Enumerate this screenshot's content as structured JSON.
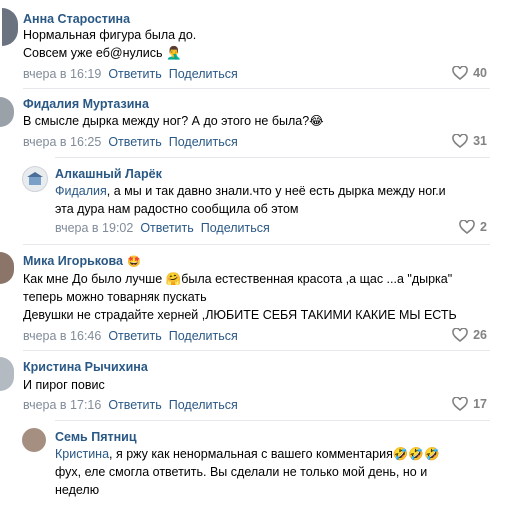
{
  "comments": [
    {
      "author": "Анна Старостина",
      "lines": [
        "Нормальная фигура была до.",
        "Совсем уже еб@нулись 🤦‍♂️"
      ],
      "time": "вчера в 16:19",
      "reply": "Ответить",
      "share": "Поделиться",
      "likes": "40"
    },
    {
      "author": "Фидалия Муртазина",
      "lines": [
        "В смысле дырка между ног? А до этого не была?😂"
      ],
      "time": "вчера в 16:25",
      "reply": "Ответить",
      "share": "Поделиться",
      "likes": "31"
    },
    {
      "author": "Алкашный Ларёк",
      "mention": "Фидалия",
      "lines": [
        ", а мы и так давно знали.что у неё есть дырка между ног.и",
        "эта дура нам радостно сообщила об этом"
      ],
      "time": "вчера в 19:02",
      "reply": "Ответить",
      "share": "Поделиться",
      "likes": "2"
    },
    {
      "author": "Мика Игорькова",
      "badge": "🤩",
      "lines": [
        "Как мне До было лучше 🤗была естественная красота ,а щас ...а \"дырка\"",
        "теперь можно товарняк пускать",
        "Девушки не страдайте херней ,ЛЮБИТЕ СЕБЯ ТАКИМИ КАКИЕ МЫ ЕСТЬ"
      ],
      "time": "вчера в 16:46",
      "reply": "Ответить",
      "share": "Поделиться",
      "likes": "26"
    },
    {
      "author": "Кристина Рычихина",
      "lines": [
        "И пирог повис"
      ],
      "time": "вчера в 17:16",
      "reply": "Ответить",
      "share": "Поделиться",
      "likes": "17"
    },
    {
      "author": "Семь Пятниц",
      "mention": "Кристина",
      "lines": [
        ", я ржу как ненормальная с вашего комментария🤣🤣🤣",
        "фух, еле смогла ответить. Вы сделали не только мой день, но и",
        "неделю"
      ],
      "time": "",
      "reply": "",
      "share": "",
      "likes": ""
    }
  ]
}
